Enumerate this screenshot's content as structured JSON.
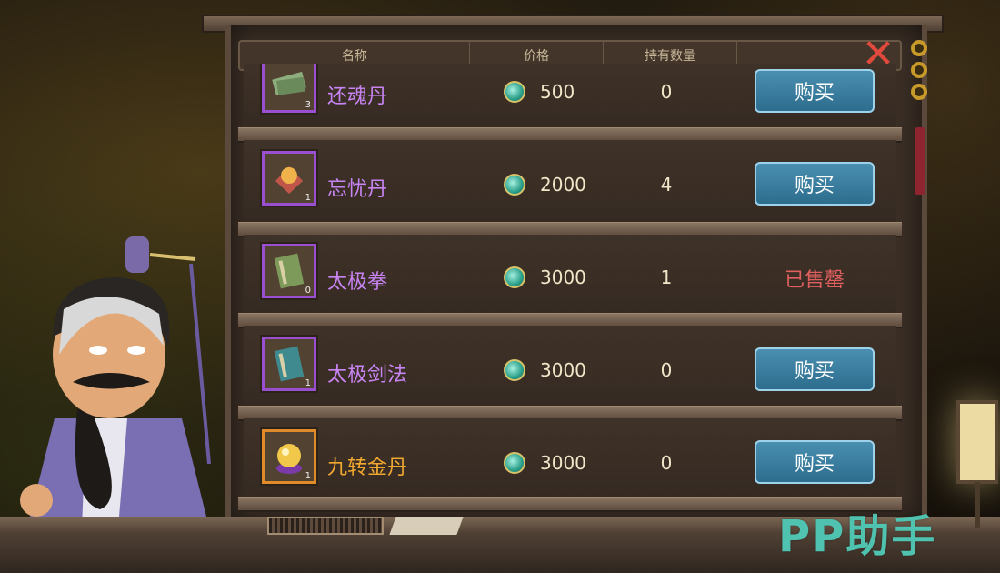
{
  "header": {
    "name": "名称",
    "price": "价格",
    "held": "持有数量"
  },
  "items": [
    {
      "name": "还魂丹",
      "icon": "green-bills-icon",
      "count": "3",
      "price": "500",
      "held": "0",
      "action": "购买",
      "status": "buy",
      "rarity": "purple"
    },
    {
      "name": "忘忧丹",
      "icon": "orange-orb-icon",
      "count": "1",
      "price": "2000",
      "held": "4",
      "action": "购买",
      "status": "buy",
      "rarity": "purple"
    },
    {
      "name": "太极拳",
      "icon": "green-book-icon",
      "count": "0",
      "price": "3000",
      "held": "1",
      "action": "已售罄",
      "status": "sold-out",
      "rarity": "purple"
    },
    {
      "name": "太极剑法",
      "icon": "teal-book-icon",
      "count": "1",
      "price": "3000",
      "held": "0",
      "action": "购买",
      "status": "buy",
      "rarity": "purple"
    },
    {
      "name": "九转金丹",
      "icon": "golden-pearl-icon",
      "count": "1",
      "price": "3000",
      "held": "0",
      "action": "购买",
      "status": "buy",
      "rarity": "gold"
    }
  ],
  "colors": {
    "purple_name": "#c884f2",
    "gold_name": "#f0a830",
    "buy_button": "#3a7fa0",
    "sold_out": "#e06060"
  },
  "watermark": "PP助手"
}
